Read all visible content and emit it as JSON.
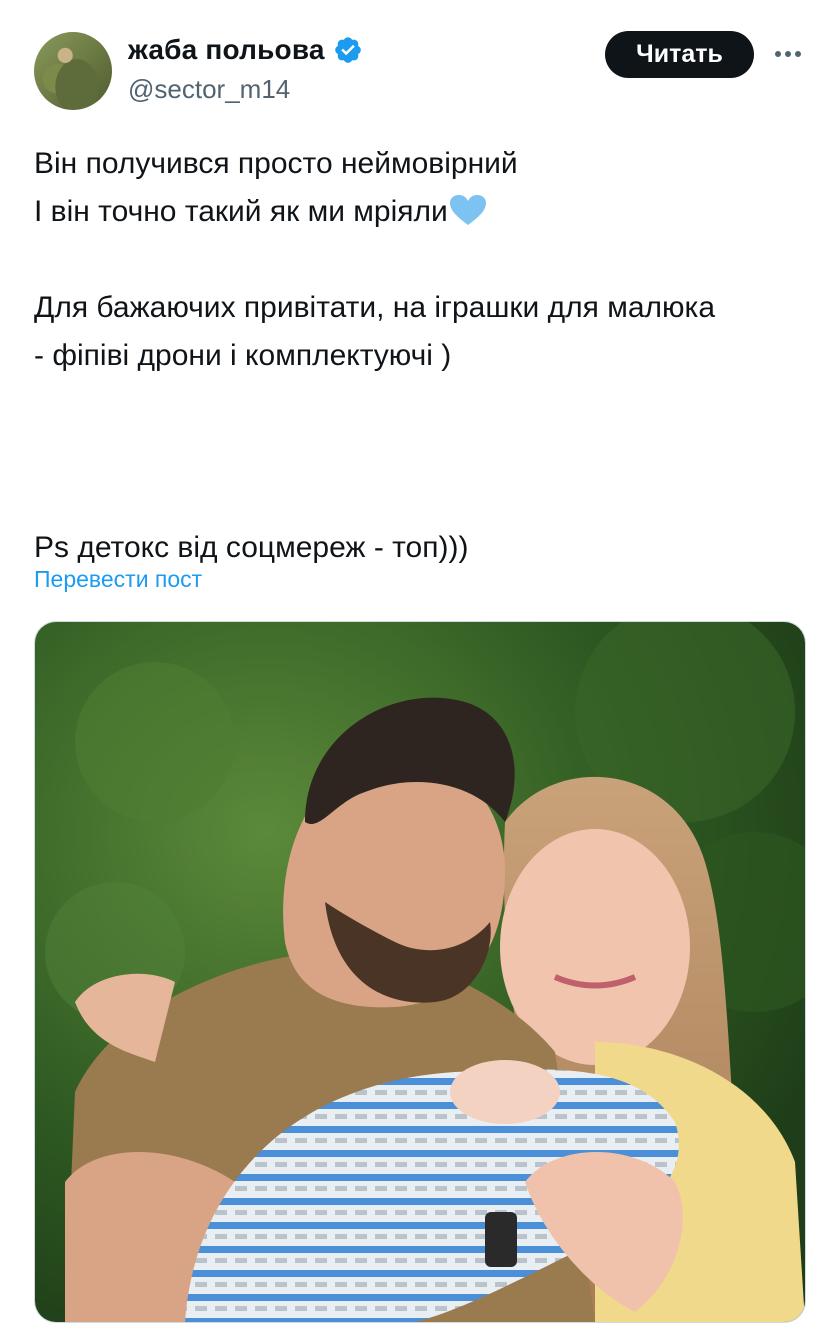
{
  "author": {
    "display_name": "жаба польова",
    "handle": "@sector_m14",
    "verified_icon": "verified-badge-icon",
    "verified_color": "#1d9bf0"
  },
  "actions": {
    "follow_label": "Читать",
    "more_icon": "more-horizontal-icon"
  },
  "tweet": {
    "lines": [
      "Він получився просто неймовірний",
      "І він точно такий як ми мріяли",
      "",
      "Для бажаючих привітати, на іграшки для малюка",
      "- фіпіві дрони і комплектуючі )",
      "",
      "",
      "",
      "Ps детокс від соцмереж - топ)))"
    ],
    "emoji": "blue-heart-icon",
    "translate_label": "Перевести пост"
  },
  "media": {
    "type": "photo",
    "content": "family-photo"
  },
  "colors": {
    "text": "#0f1419",
    "secondary": "#536471",
    "link": "#1d9bf0",
    "button_bg": "#0f1419"
  }
}
